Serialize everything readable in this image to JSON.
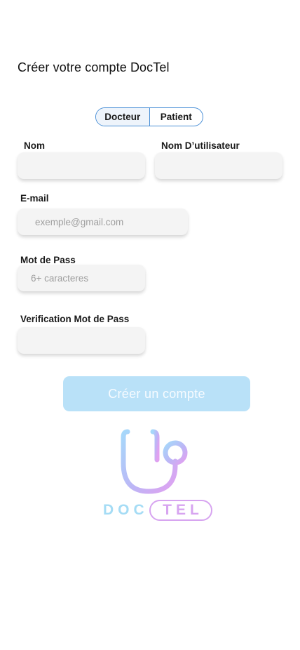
{
  "header": {
    "title": "Créer votre compte DocTel"
  },
  "account_type": {
    "options": [
      "Docteur",
      "Patient"
    ],
    "selected": "Docteur"
  },
  "form": {
    "nom": {
      "label": "Nom",
      "value": "",
      "placeholder": ""
    },
    "username": {
      "label": "Nom D’utilisateur",
      "value": "",
      "placeholder": ""
    },
    "email": {
      "label": "E-mail",
      "value": "",
      "placeholder": "exemple@gmail.com"
    },
    "password": {
      "label": "Mot de Pass",
      "value": "",
      "placeholder": "6+ caracteres"
    },
    "password_confirm": {
      "label": "Verification Mot de Pass",
      "value": "",
      "placeholder": ""
    }
  },
  "submit": {
    "label": "Créer un compte"
  },
  "logo": {
    "left_text": "DOC",
    "right_text": "TEL",
    "icon": "stethoscope-icon"
  },
  "colors": {
    "accent_blue": "#4a8fd6",
    "button_bg": "#b9e1f8",
    "logo_blue": "#a5dcf5",
    "logo_purple": "#d7a4f0"
  }
}
